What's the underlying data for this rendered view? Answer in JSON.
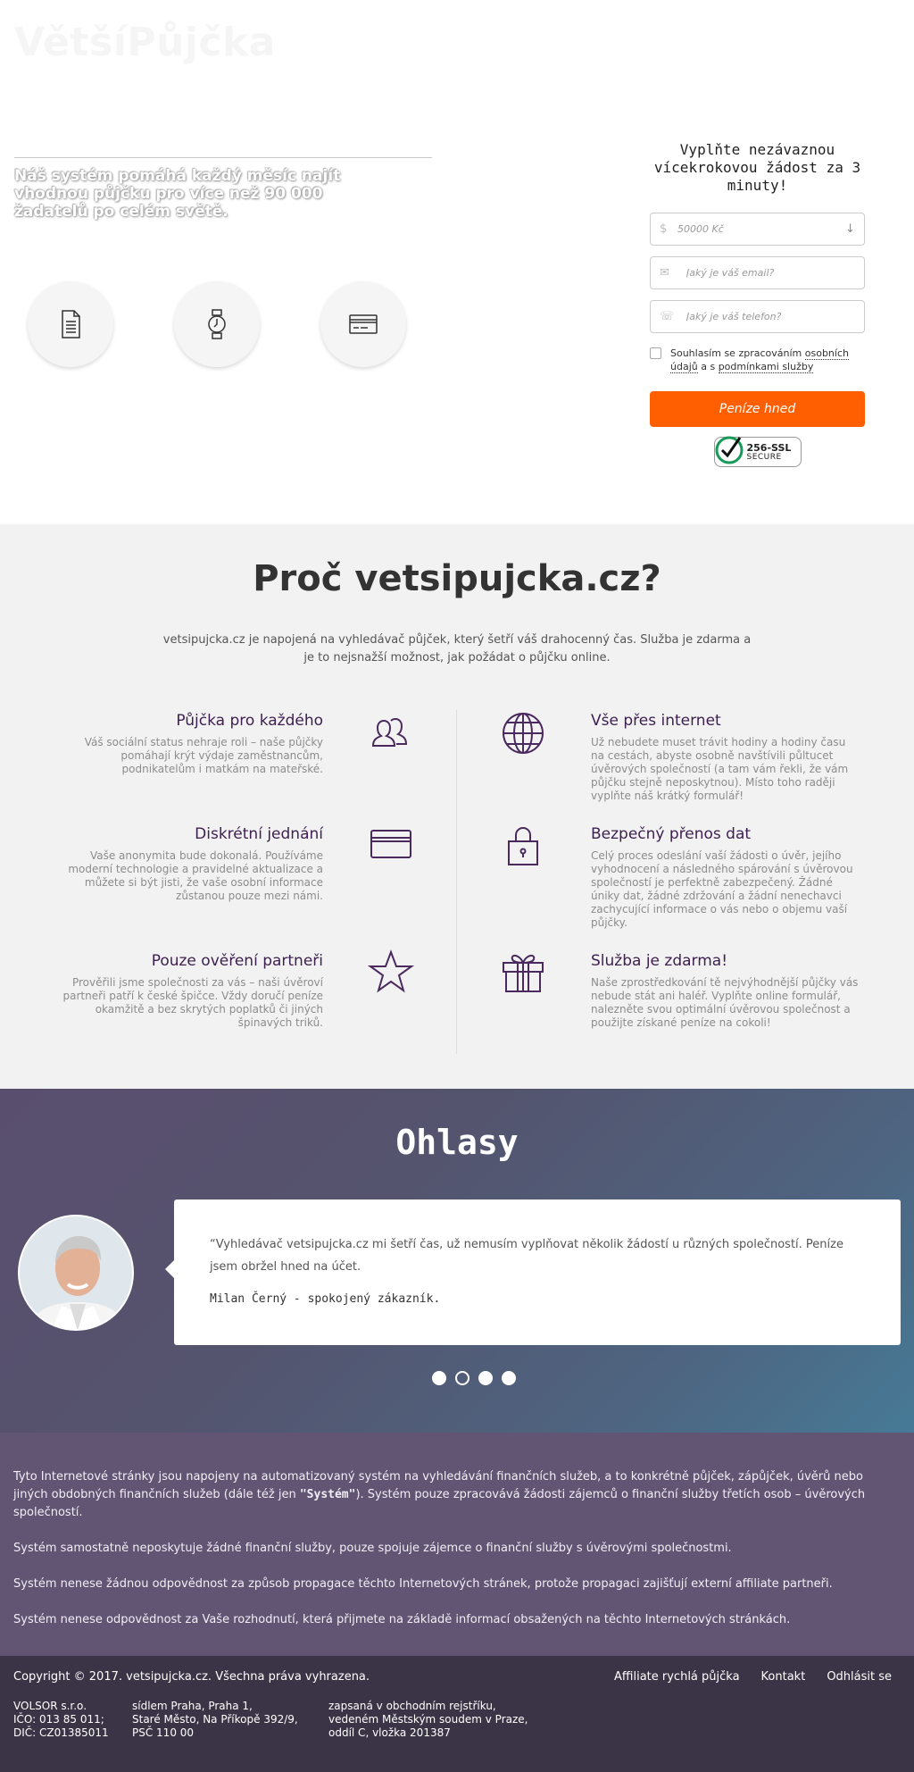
{
  "hero": {
    "logo": "VětšíPůjčka",
    "text": "Náš systém pomáhá každý měsíc najít vhodnou půjčku pro více než 90 000 žadatelů po celém světě.",
    "icons": [
      "document-icon",
      "watch-icon",
      "credit-card-icon"
    ]
  },
  "form": {
    "title": "Vyplňte nezávaznou vícekrokovou žádost za 3 minuty!",
    "amount_placeholder": "50000 Kč",
    "email_placeholder": "Jaký je váš email?",
    "phone_placeholder": "Jaký je váš telefon?",
    "consent_prefix": "Souhlasím se zpracováním",
    "consent_link1": "osobních údajů",
    "consent_mid": "a s",
    "consent_link2": "podmínkami služby",
    "submit": "Peníze hned",
    "ssl_line1": "256-SSL",
    "ssl_line2": "SECURE"
  },
  "why": {
    "title": "Proč vetsipujcka.cz?",
    "intro": "vetsipujcka.cz je napojená na vyhledávač půjček, který šetří váš drahocenný čas. Služba je zdarma a je to nejsnažší možnost, jak požádat o půjčku online.",
    "features": [
      {
        "title": "Půjčka pro každého",
        "text": "Váš sociální status nehraje roli – naše půjčky pomáhají krýt výdaje zaměstnancům, podnikatelům i matkám na mateřské.",
        "icon": "users-icon"
      },
      {
        "title": "Vše přes internet",
        "text": "Už nebudete muset trávit hodiny a hodiny času na cestách, abyste osobně navštívili půltucet úvěrových společností (a tam vám řekli, že vám půjčku stejně neposkytnou). Místo toho raději vyplňte náš krátký formulář!",
        "icon": "globe-icon"
      },
      {
        "title": "Diskrétní jednání",
        "text": "Vaše anonymita bude dokonalá. Používáme moderní technologie a pravidelné aktualizace a můžete si být jisti, že vaše osobní informace zůstanou pouze mezi námi.",
        "icon": "card-icon"
      },
      {
        "title": "Bezpečný přenos dat",
        "text": "Celý proces odeslání vaší žádosti o úvěr, jejího vyhodnocení a následného spárování s úvěrovou společností je perfektně zabezpečený. Žádné úniky dat, žádné zdržování a žádní nenechavci zachycující informace o vás nebo o objemu vaší půjčky.",
        "icon": "lock-icon"
      },
      {
        "title": "Pouze ověření partneři",
        "text": "Prověřili jsme společnosti za vás – naši úvěroví partneři patří k české špičce. Vždy doručí peníze okamžitě a bez skrytých poplatků či jiných špinavých triků.",
        "icon": "star-icon"
      },
      {
        "title": "Služba je zdarma!",
        "text": "Naše zprostředkování tě nejvýhodnější půjčky vás nebude stát ani haléř. Vyplňte online formulář, nalezněte svou optimální úvěrovou společnost a použijte získané peníze na cokoli!",
        "icon": "gift-icon"
      }
    ]
  },
  "testimonials": {
    "title": "Ohlasy",
    "quote": "“Vyhledávač vetsipujcka.cz mi šetří čas, už nemusím vyplňovat několik žádostí u různých společností. Peníze jsem obržel hned na účet.",
    "author": "Milan Černý - spokojený zákazník.",
    "active_dot": 1
  },
  "disclaimer": {
    "p1_before": "Tyto Internetové stránky jsou napojeny na automatizovaný systém na vyhledávání finančních služeb, a to konkrétně půjček, zápůjček, úvěrů nebo jiných obdobných finančních služeb (dále též jen ",
    "p1_bold": "\"Systém\"",
    "p1_after": "). Systém pouze zpracovává žádosti zájemců o finanční služby třetích osob – úvěrových společností.",
    "p2": "Systém samostatně neposkytuje žádné finanční služby, pouze spojuje zájemce o finanční služby s úvěrovými společnostmi.",
    "p3": "Systém nenese žádnou odpovědnost za způsob propagace těchto Internetových stránek, protože propagaci zajišťují externí affiliate partneři.",
    "p4": "Systém nenese odpovědnost za Vaše rozhodnutí, která přijmete na základě informací obsažených na těchto Internetových stránkách."
  },
  "footer": {
    "copyright": "Copyright © 2017. vetsipujcka.cz. Všechna práva vyhrazena.",
    "nav": [
      "Affiliate rychlá půjčka",
      "Kontakt",
      "Odhlásit se"
    ],
    "col1": [
      "VOLSOR s.r.o.",
      "IČO: 013 85 011;",
      "DIČ: CZ01385011"
    ],
    "col2": [
      "sídlem Praha, Praha 1,",
      "Staré Město, Na Příkopě 392/9,",
      "PSČ 110 00"
    ],
    "col3": [
      "zapsaná v obchodním rejstříku,",
      "vedeném Městským soudem v Praze,",
      "oddíl C, vložka 201387"
    ]
  },
  "colors": {
    "accent": "#ff5f00",
    "purple": "#3d1f4f",
    "disclaimer_bg": "#615573",
    "footer_bg": "#3a3446"
  }
}
